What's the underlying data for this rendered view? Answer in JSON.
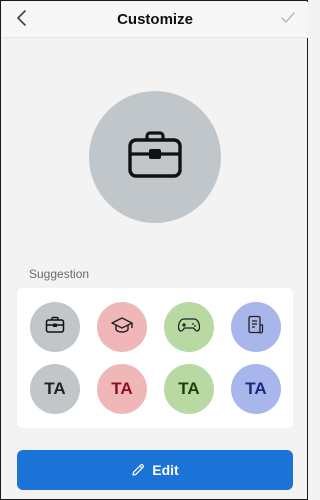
{
  "header": {
    "title": "Customize",
    "back_icon": "chevron-left-icon",
    "confirm_icon": "checkmark-icon"
  },
  "preview": {
    "icon": "briefcase-icon",
    "background": "#c0c6c9"
  },
  "suggestions": {
    "label": "Suggestion",
    "icon_options": [
      {
        "icon": "briefcase-icon",
        "background": "#c0c6c9"
      },
      {
        "icon": "graduation-cap-icon",
        "background": "#f0b7b9"
      },
      {
        "icon": "game-controller-icon",
        "background": "#b9d9a3"
      },
      {
        "icon": "document-icon",
        "background": "#a9b6ec"
      }
    ],
    "text_options": [
      {
        "text": "TA",
        "background": "#c0c6c9",
        "color": "#222222"
      },
      {
        "text": "TA",
        "background": "#f0b7b9",
        "color": "#8a1020"
      },
      {
        "text": "TA",
        "background": "#b9d9a3",
        "color": "#1f3d12"
      },
      {
        "text": "TA",
        "background": "#a9b6ec",
        "color": "#1a2a7a"
      }
    ]
  },
  "edit_button": {
    "label": "Edit",
    "icon": "pencil-icon",
    "color": "#1b73d8"
  }
}
